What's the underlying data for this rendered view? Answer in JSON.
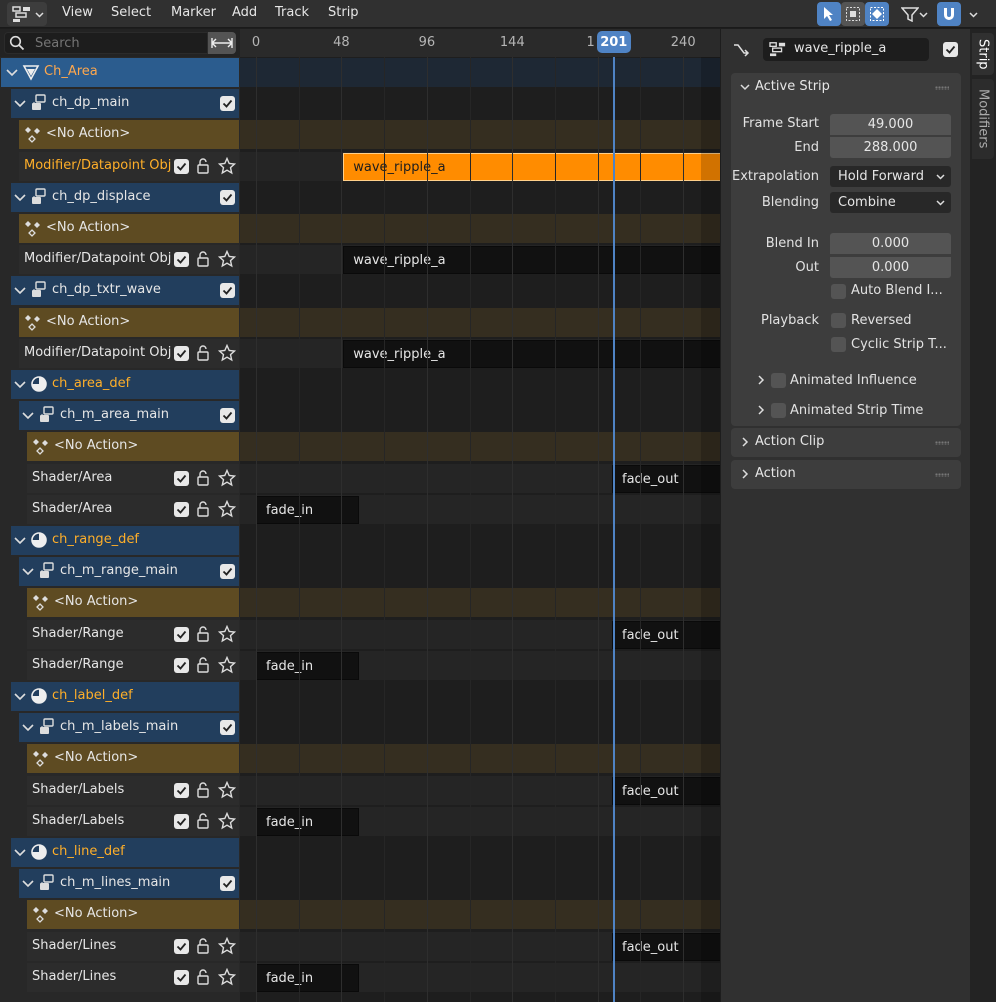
{
  "menubar": {
    "items": [
      "View",
      "Select",
      "Marker",
      "Add",
      "Track",
      "Strip"
    ]
  },
  "search": {
    "placeholder": "Search"
  },
  "ruler": {
    "frames": [
      {
        "label": "0",
        "frame": 0
      },
      {
        "label": "48",
        "frame": 48
      },
      {
        "label": "96",
        "frame": 96
      },
      {
        "label": "144",
        "frame": 144
      },
      {
        "label": "1",
        "frame": 188
      },
      {
        "label": "240",
        "frame": 240
      }
    ],
    "current_frame": "201"
  },
  "channels": [
    {
      "label": "Ch_Area",
      "type": "scene",
      "indent": 0,
      "checkbox": false
    },
    {
      "label": "ch_dp_main",
      "type": "object",
      "indent": 1,
      "checkbox": true
    },
    {
      "label": "<No Action>",
      "type": "action",
      "indent": 2
    },
    {
      "label": "Modifier/Datapoint Obj",
      "type": "track",
      "indent": 2,
      "active": true
    },
    {
      "label": "ch_dp_displace",
      "type": "object",
      "indent": 1,
      "checkbox": true
    },
    {
      "label": "<No Action>",
      "type": "action",
      "indent": 2
    },
    {
      "label": "Modifier/Datapoint Obj",
      "type": "track",
      "indent": 2
    },
    {
      "label": "ch_dp_txtr_wave",
      "type": "object",
      "indent": 1,
      "checkbox": true
    },
    {
      "label": "<No Action>",
      "type": "action",
      "indent": 2
    },
    {
      "label": "Modifier/Datapoint Obj",
      "type": "track",
      "indent": 2
    },
    {
      "label": "ch_area_def",
      "type": "material",
      "indent": 1
    },
    {
      "label": "ch_m_area_main",
      "type": "object",
      "indent": 2,
      "checkbox": true
    },
    {
      "label": "<No Action>",
      "type": "action",
      "indent": 3
    },
    {
      "label": "Shader/Area",
      "type": "track",
      "indent": 3
    },
    {
      "label": "Shader/Area",
      "type": "track",
      "indent": 3
    },
    {
      "label": "ch_range_def",
      "type": "material",
      "indent": 1
    },
    {
      "label": "ch_m_range_main",
      "type": "object",
      "indent": 2,
      "checkbox": true
    },
    {
      "label": "<No Action>",
      "type": "action",
      "indent": 3
    },
    {
      "label": "Shader/Range",
      "type": "track",
      "indent": 3
    },
    {
      "label": "Shader/Range",
      "type": "track",
      "indent": 3
    },
    {
      "label": "ch_label_def",
      "type": "material",
      "indent": 1
    },
    {
      "label": "ch_m_labels_main",
      "type": "object",
      "indent": 2,
      "checkbox": true
    },
    {
      "label": "<No Action>",
      "type": "action",
      "indent": 3
    },
    {
      "label": "Shader/Labels",
      "type": "track",
      "indent": 3
    },
    {
      "label": "Shader/Labels",
      "type": "track",
      "indent": 3
    },
    {
      "label": "ch_line_def",
      "type": "material",
      "indent": 1
    },
    {
      "label": "ch_m_lines_main",
      "type": "object",
      "indent": 2,
      "checkbox": true
    },
    {
      "label": "<No Action>",
      "type": "action",
      "indent": 3
    },
    {
      "label": "Shader/Lines",
      "type": "track",
      "indent": 3
    },
    {
      "label": "Shader/Lines",
      "type": "track",
      "indent": 3
    }
  ],
  "strips": [
    {
      "row": 3,
      "label": "wave_ripple_a",
      "start": 49,
      "end": 288,
      "selected": true
    },
    {
      "row": 6,
      "label": "wave_ripple_a",
      "start": 49,
      "end": 288
    },
    {
      "row": 9,
      "label": "wave_ripple_a",
      "start": 49,
      "end": 288
    },
    {
      "row": 13,
      "label": "fade_out",
      "start": 200,
      "end": 288
    },
    {
      "row": 14,
      "label": "fade_in",
      "start": 0,
      "end": 58
    },
    {
      "row": 18,
      "label": "fade_out",
      "start": 200,
      "end": 288
    },
    {
      "row": 19,
      "label": "fade_in",
      "start": 0,
      "end": 58
    },
    {
      "row": 23,
      "label": "fade_out",
      "start": 200,
      "end": 288
    },
    {
      "row": 24,
      "label": "fade_in",
      "start": 0,
      "end": 58
    },
    {
      "row": 28,
      "label": "fade_out",
      "start": 200,
      "end": 288
    },
    {
      "row": 29,
      "label": "fade_in",
      "start": 0,
      "end": 58
    }
  ],
  "sidebar": {
    "strip_name": "wave_ripple_a",
    "active_strip": {
      "title": "Active Strip",
      "frame_start_label": "Frame Start",
      "frame_start": "49.000",
      "end_label": "End",
      "end": "288.000",
      "extrapolation_label": "Extrapolation",
      "extrapolation": "Hold Forward",
      "blending_label": "Blending",
      "blending": "Combine",
      "blend_in_label": "Blend In",
      "blend_in": "0.000",
      "out_label": "Out",
      "out": "0.000",
      "auto_blend": "Auto Blend I...",
      "playback_label": "Playback",
      "reversed": "Reversed",
      "cyclic": "Cyclic Strip T...",
      "animated_influence": "Animated Influence",
      "animated_strip_time": "Animated Strip Time"
    },
    "action_clip": "Action Clip",
    "action": "Action"
  },
  "tabs": {
    "strip": "Strip",
    "modifiers": "Modifiers"
  },
  "colors": {
    "accent": "#4f83c4",
    "selected_strip": "#ff8c00",
    "object_row": "#223e5d",
    "action_row": "#5e4b22"
  }
}
